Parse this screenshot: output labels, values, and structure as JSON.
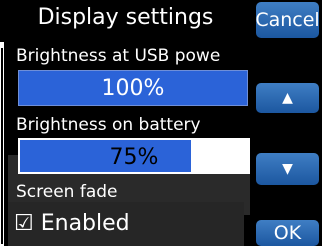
{
  "header": {
    "title": "Display settings"
  },
  "settings": {
    "usb": {
      "label": "Brightness at USB powe",
      "value": "100%",
      "level": 1.0
    },
    "battery": {
      "label": "Brightness on battery",
      "value": "75%",
      "level": 0.75
    },
    "fade": {
      "label": "Screen fade",
      "checkbox": "☑",
      "value": "Enabled"
    }
  },
  "buttons": {
    "cancel": "Cancel",
    "up": "▲",
    "down": "▼",
    "ok": "OK"
  },
  "colors": {
    "accent": "#2b63d8",
    "button": "#2a6cc0",
    "background": "#000000"
  }
}
